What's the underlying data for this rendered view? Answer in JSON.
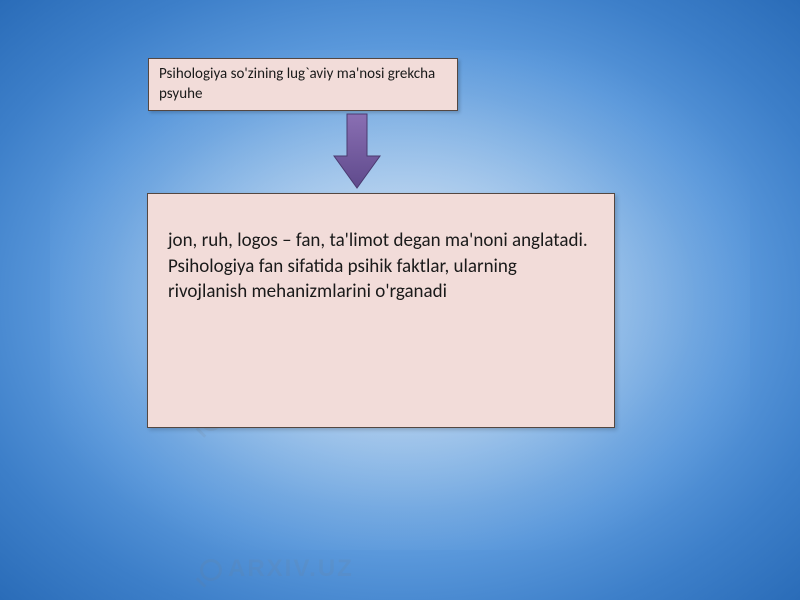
{
  "watermark": {
    "text": "ARXIV.UZ"
  },
  "top_box": {
    "text": "Psihologiya so'zining lug`aviy ma'nosi grekcha psyuhe"
  },
  "bottom_box": {
    "text": "jon, ruh, logos – fan, ta'limot degan ma'noni anglatadi. Psihologiya fan sifatida psihik faktlar,  ularning rivojlanish mehanizmlarini o'rganadi"
  },
  "arrow": {
    "direction": "down",
    "fill_start": "#8a6fb3",
    "fill_end": "#5f4a8c",
    "stroke": "#4a3a6f"
  }
}
